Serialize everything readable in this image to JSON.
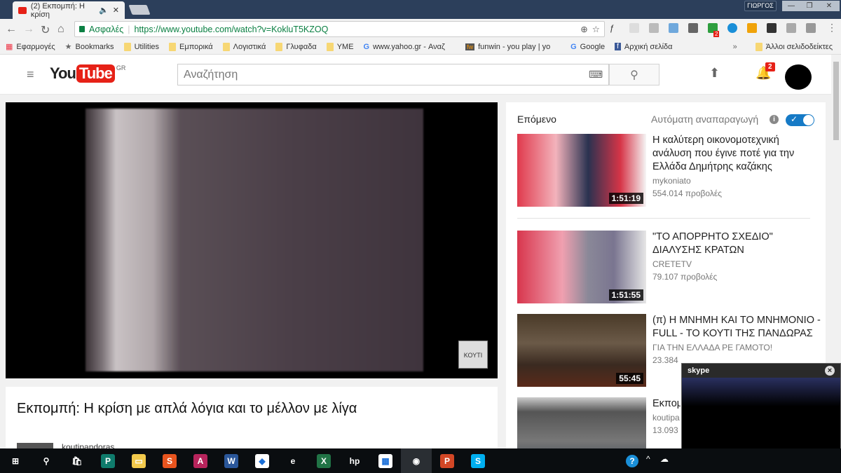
{
  "browser": {
    "tab_title": "(2) Εκπομπή: Η κρίση",
    "user": "ΓΙΩΡΓΟΣ",
    "secure_label": "Ασφαλές",
    "url": "https://www.youtube.com/watch?v=KokluT5KZOQ",
    "bookmarks": [
      "Εφαρμογές",
      "Bookmarks",
      "Utilities",
      "Εμπορικά",
      "Λογιστικά",
      "Γλυφαδα",
      "ΥΜΕ",
      "www.yahoo.gr - Αναζ",
      "funwin - you play | yo",
      "Google",
      "Αρχική σελίδα"
    ],
    "other_bookmarks": "Άλλοι σελιδοδείκτες",
    "more": "»",
    "ext_badge": "2"
  },
  "youtube": {
    "logo_you": "You",
    "logo_tube": "Tube",
    "region": "GR",
    "search_placeholder": "Αναζήτηση",
    "notif_count": "2",
    "watermark": "ΚΟΥΤΙ",
    "video_title": "Εκπομπή: Η κρίση με απλά λόγια και το μέλλον με λίγα",
    "channel": "koutipandoras",
    "up_next": "Επόμενο",
    "autoplay": "Αυτόματη αναπαραγωγή",
    "related": [
      {
        "title": "Η καλύτερη οικονομοτεχνική ανάλυση που έγινε ποτέ για την Ελλάδα Δημήτρης καζάκης",
        "channel": "mykoniato",
        "views": "554.014 προβολές",
        "duration": "1:51:19"
      },
      {
        "title": "\"ΤΟ ΑΠΟΡΡΗΤΟ ΣΧΕΔΙΟ\" ΔΙΑΛΥΣΗΣ ΚΡΑΤΩΝ",
        "channel": "CRETETV",
        "views": "79.107 προβολές",
        "duration": "1:51:55"
      },
      {
        "title": "(π) Η ΜΝΗΜΗ ΚΑΙ ΤΟ ΜΝΗΜΟΝΙΟ -FULL - ΤΟ ΚΟΥΤΙ ΤΗΣ ΠΑΝΔΩΡΑΣ",
        "channel": "ΓΙΑ ΤΗΝ ΕΛΛΑΔΑ ΡΕ ΓΑΜΟΤΟ!",
        "views": "23.384",
        "duration": "55:45"
      },
      {
        "title": "Εκπομ που ό",
        "channel": "koutipa",
        "views": "13.093",
        "duration": ""
      }
    ]
  },
  "skype": {
    "label": "skype",
    "close": "×"
  },
  "taskbar": {
    "apps": [
      {
        "name": "start",
        "glyph": "⊞",
        "color": "transparent"
      },
      {
        "name": "search",
        "glyph": "⚲",
        "color": "transparent"
      },
      {
        "name": "store",
        "glyph": "🛍",
        "color": "transparent"
      },
      {
        "name": "publisher",
        "glyph": "P",
        "color": "#0f7b6c"
      },
      {
        "name": "file-explorer",
        "glyph": "▭",
        "color": "#f2c94c"
      },
      {
        "name": "app-s",
        "glyph": "S",
        "color": "#e8541e"
      },
      {
        "name": "access",
        "glyph": "A",
        "color": "#b7245c"
      },
      {
        "name": "word",
        "glyph": "W",
        "color": "#2b579a"
      },
      {
        "name": "dropbox",
        "glyph": "◆",
        "color": "#ffffff"
      },
      {
        "name": "edge",
        "glyph": "e",
        "color": "transparent"
      },
      {
        "name": "excel",
        "glyph": "X",
        "color": "#217346"
      },
      {
        "name": "hp",
        "glyph": "hp",
        "color": "transparent"
      },
      {
        "name": "apps-grid",
        "glyph": "▦",
        "color": "#ffffff"
      },
      {
        "name": "chrome",
        "glyph": "◉",
        "color": "transparent"
      },
      {
        "name": "powerpoint",
        "glyph": "P",
        "color": "#d24726"
      },
      {
        "name": "skype",
        "glyph": "S",
        "color": "#00aff0"
      }
    ]
  }
}
